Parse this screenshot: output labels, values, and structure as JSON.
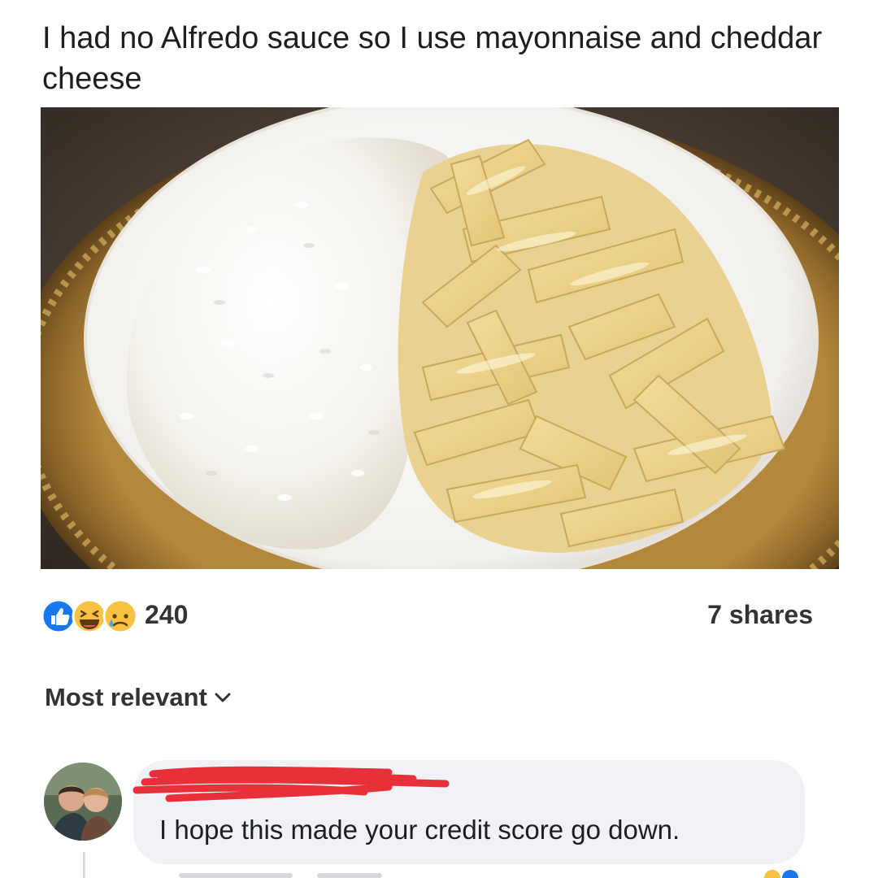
{
  "post": {
    "text": "I had no Alfredo sauce so I use mayonnaise and cheddar cheese"
  },
  "photo": {
    "subject": "plate of white rice and penne pasta with creamy cheese sauce"
  },
  "reactions": {
    "icons": [
      "like-icon",
      "haha-icon",
      "sad-icon"
    ],
    "count": "240"
  },
  "shares": "7 shares",
  "comments": {
    "sort_label": "Most relevant",
    "items": [
      {
        "author": "",
        "text": "I hope this made your credit score go down."
      }
    ]
  },
  "colors": {
    "like_blue": "#1877f2",
    "emoji_yellow": "#f7c142",
    "redaction_red": "#e8303a",
    "bubble_gray": "#f0f2f5"
  }
}
